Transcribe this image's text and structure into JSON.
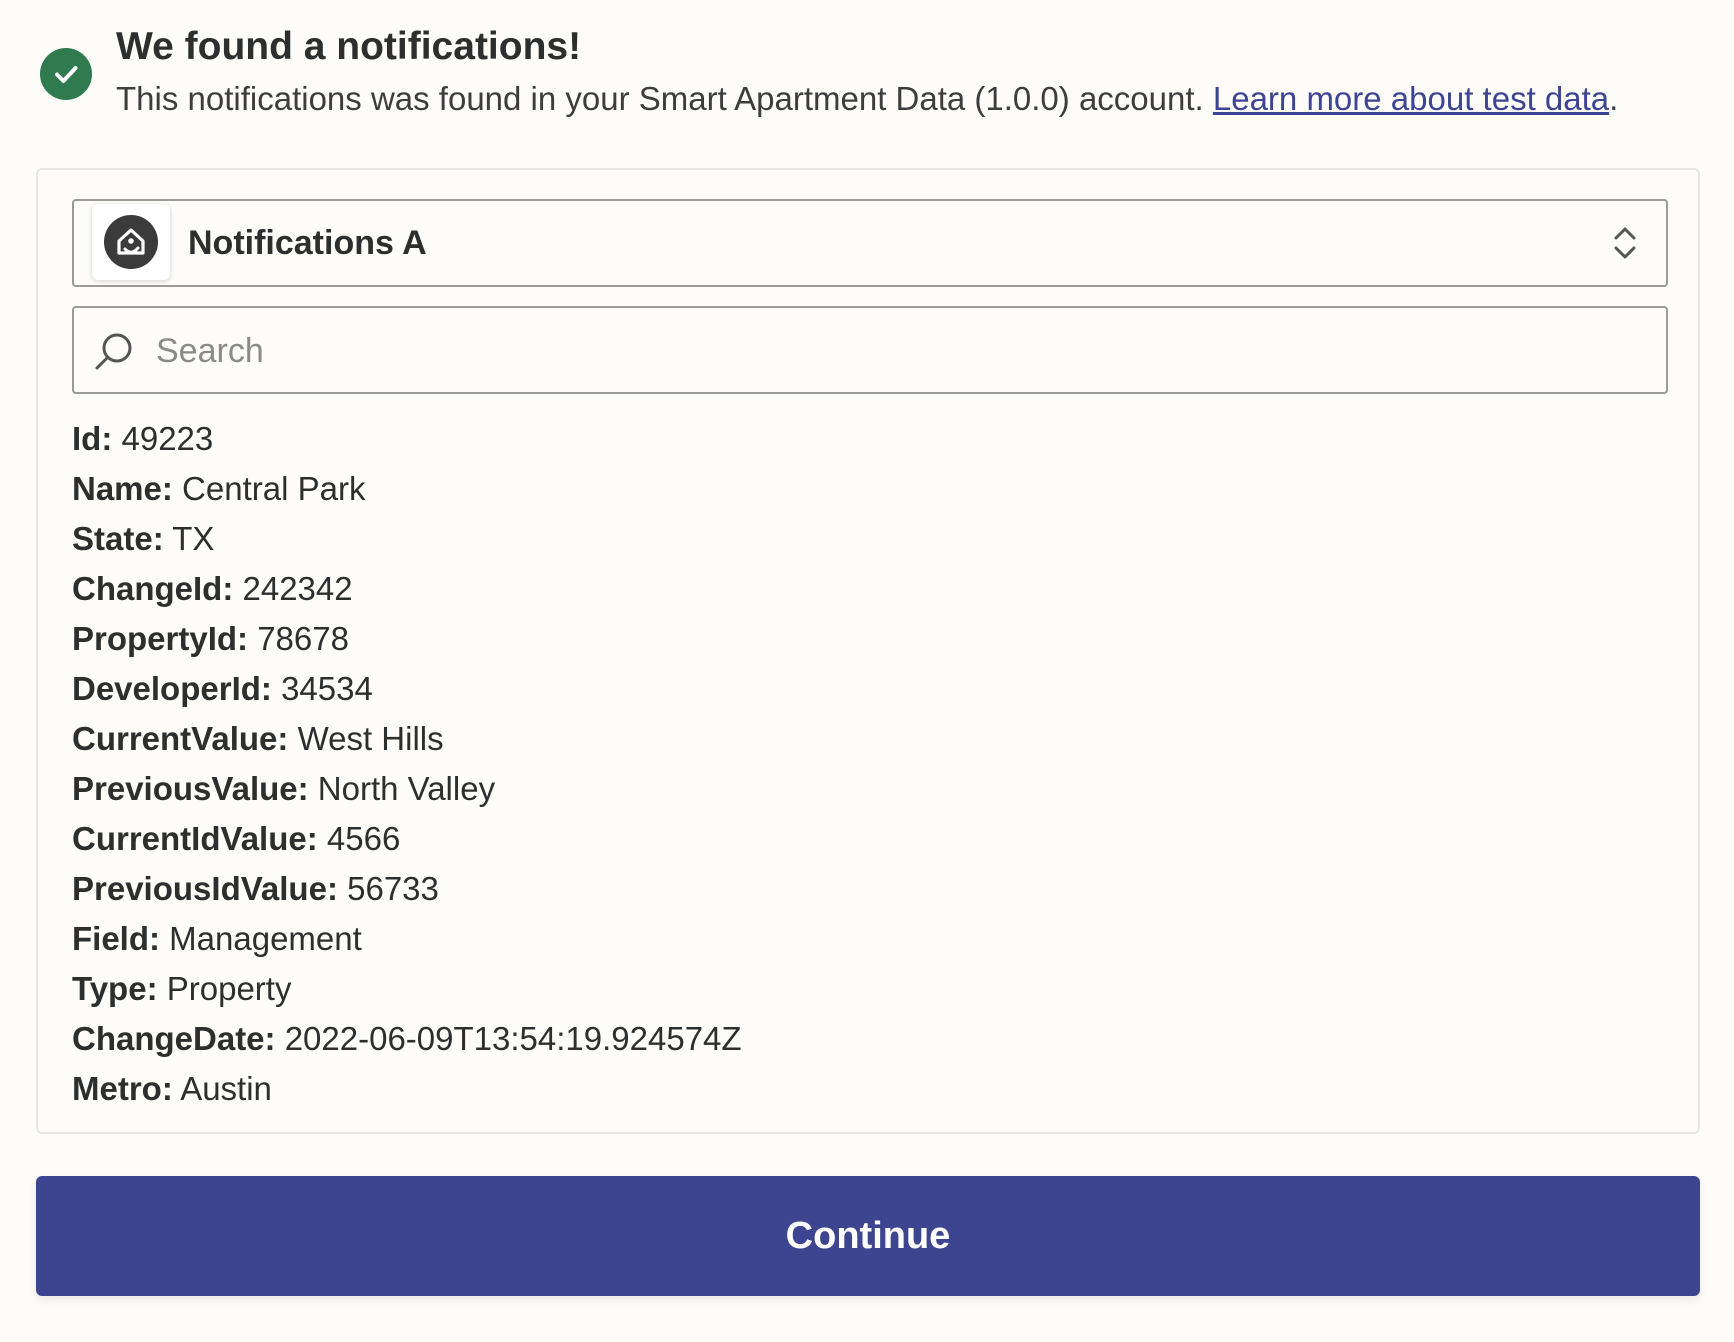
{
  "header": {
    "title": "We found a notifications!",
    "subtitle_text": "This notifications was found in your Smart Apartment Data (1.0.0) account.",
    "learn_more_link": "Learn more about test data",
    "subtitle_end": "."
  },
  "selector": {
    "label": "Notifications A",
    "app_icon": "smart-apartment-house-icon"
  },
  "search": {
    "placeholder": "Search",
    "value": ""
  },
  "fields": [
    {
      "key": "Id:",
      "value": "49223"
    },
    {
      "key": "Name:",
      "value": "Central Park"
    },
    {
      "key": "State:",
      "value": "TX"
    },
    {
      "key": "ChangeId:",
      "value": "242342"
    },
    {
      "key": "PropertyId:",
      "value": "78678"
    },
    {
      "key": "DeveloperId:",
      "value": "34534"
    },
    {
      "key": "CurrentValue:",
      "value": "West Hills"
    },
    {
      "key": "PreviousValue:",
      "value": "North Valley"
    },
    {
      "key": "CurrentIdValue:",
      "value": "4566"
    },
    {
      "key": "PreviousIdValue:",
      "value": "56733"
    },
    {
      "key": "Field:",
      "value": "Management"
    },
    {
      "key": "Type:",
      "value": "Property"
    },
    {
      "key": "ChangeDate:",
      "value": "2022-06-09T13:54:19.924574Z"
    },
    {
      "key": "Metro:",
      "value": "Austin"
    }
  ],
  "continue_label": "Continue",
  "colors": {
    "success": "#2f7a4f",
    "primary": "#3d4590",
    "link": "#3d4592",
    "background": "#fdfcf9"
  }
}
